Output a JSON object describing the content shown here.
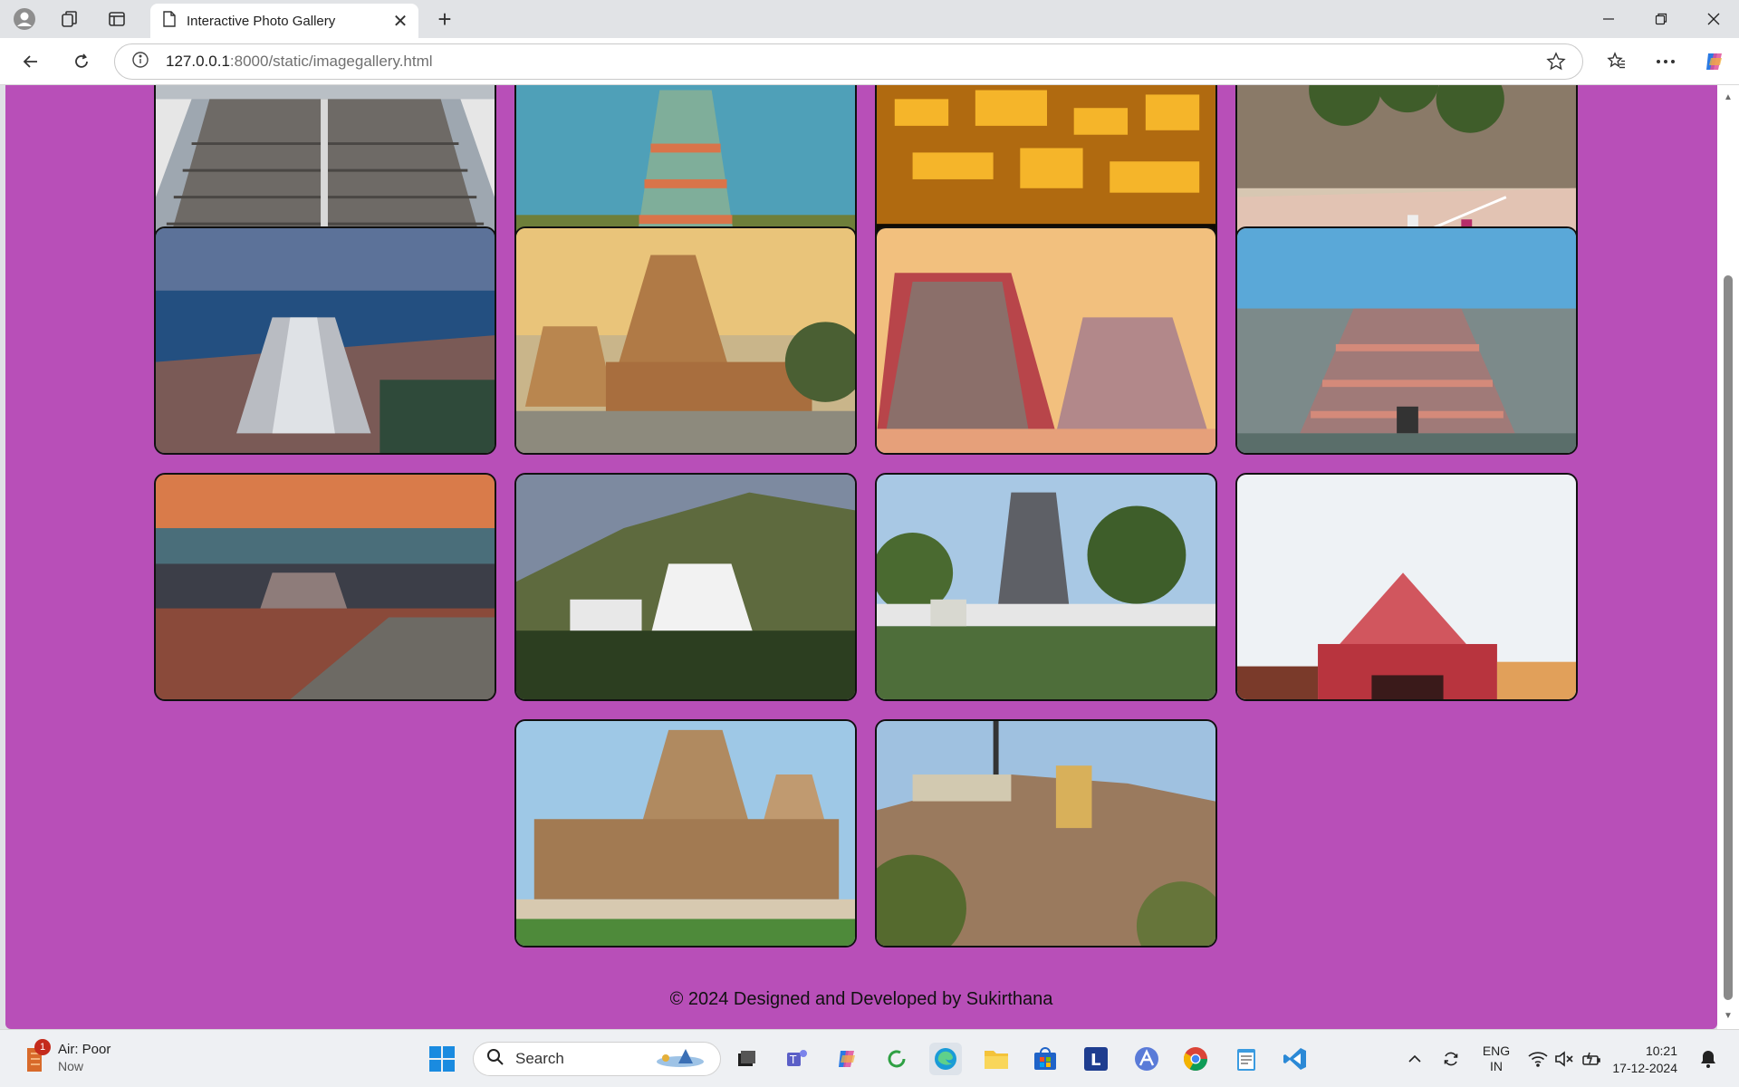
{
  "browser": {
    "tab_title": "Interactive Photo Gallery",
    "url_host": "127.0.0.1",
    "url_path": ":8000/static/imagegallery.html"
  },
  "gallery": {
    "images": [
      {
        "name": "temple-steps"
      },
      {
        "name": "gopuram-hilltop"
      },
      {
        "name": "illuminated-temple-night"
      },
      {
        "name": "temple-street"
      },
      {
        "name": "shore-temple-sea"
      },
      {
        "name": "brihadeeswarar-temple"
      },
      {
        "name": "srirangam-gopurams"
      },
      {
        "name": "aerial-gopuram-town"
      },
      {
        "name": "temple-tank-sunset"
      },
      {
        "name": "white-gopuram-hill"
      },
      {
        "name": "gopuram-tank-palms"
      },
      {
        "name": "painted-gopuram-sky"
      },
      {
        "name": "khajuraho-temple"
      },
      {
        "name": "rock-fort-temple"
      }
    ]
  },
  "footer": {
    "text": "© 2024 Designed and Developed by Sukirthana"
  },
  "taskbar": {
    "weather_title": "Air: Poor",
    "weather_sub": "Now",
    "weather_badge": "1",
    "search_placeholder": "Search",
    "lang_top": "ENG",
    "lang_bottom": "IN",
    "time": "10:21",
    "date": "17-12-2024"
  }
}
